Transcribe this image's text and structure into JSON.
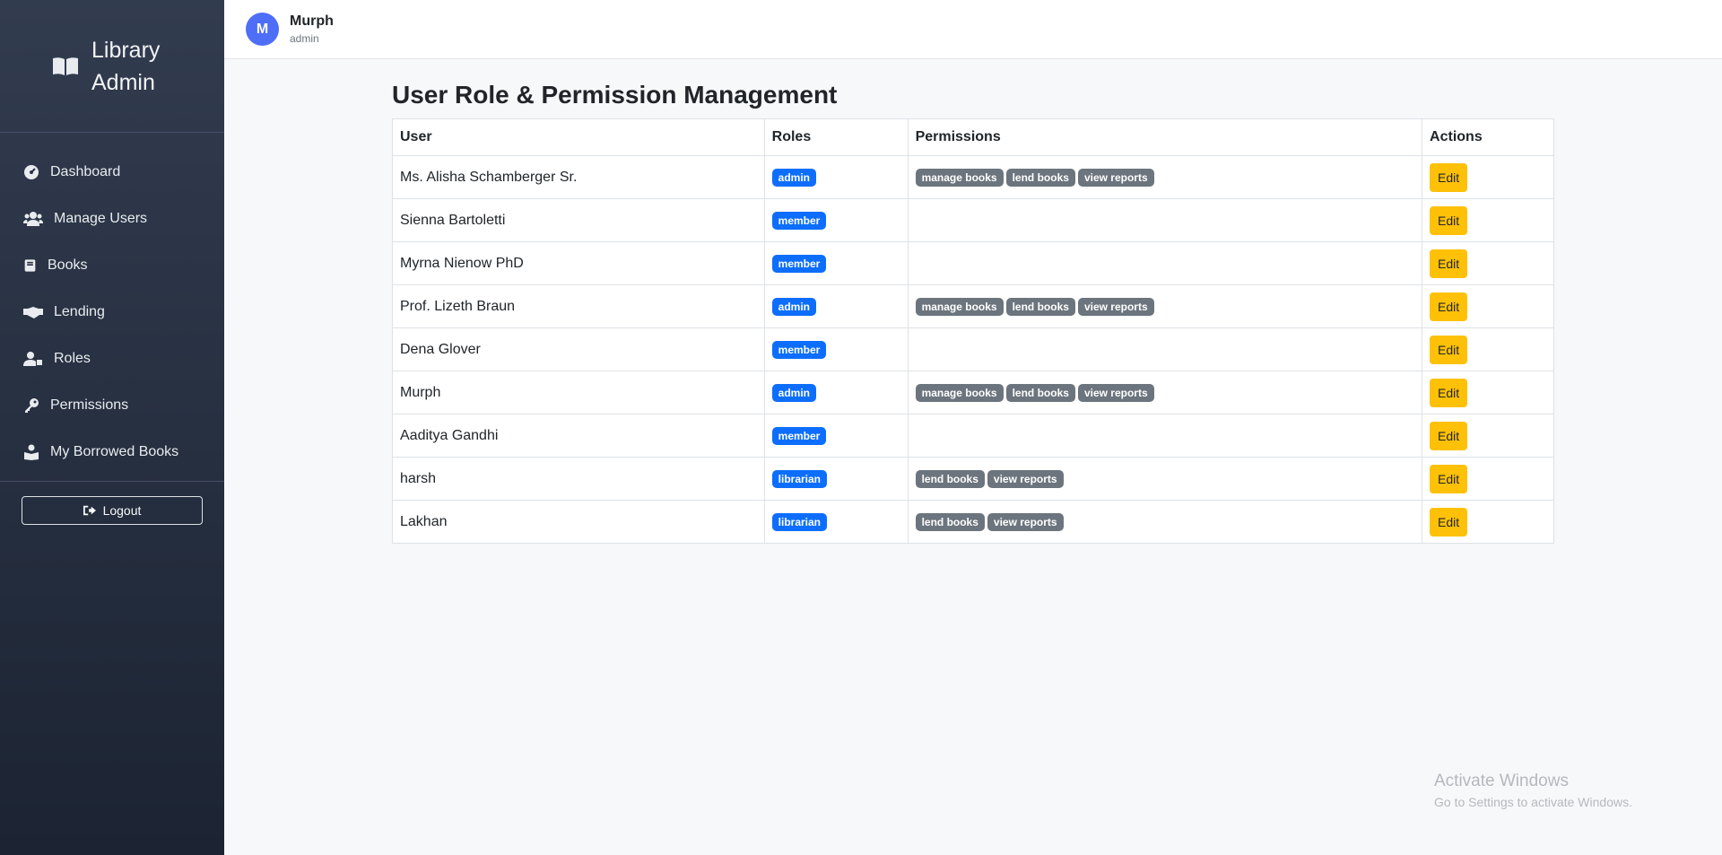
{
  "sidebar": {
    "brand": "Library Admin",
    "items": [
      {
        "label": "Dashboard",
        "icon": "dashboard-icon"
      },
      {
        "label": "Manage Users",
        "icon": "users-icon"
      },
      {
        "label": "Books",
        "icon": "book-icon"
      },
      {
        "label": "Lending",
        "icon": "handshake-icon"
      },
      {
        "label": "Roles",
        "icon": "user-tag-icon"
      },
      {
        "label": "Permissions",
        "icon": "key-icon"
      },
      {
        "label": "My Borrowed Books",
        "icon": "book-reader-icon"
      }
    ],
    "logout_label": "Logout"
  },
  "header": {
    "avatar_initial": "M",
    "user_name": "Murph",
    "user_role": "admin"
  },
  "main": {
    "title": "User Role & Permission Management",
    "columns": [
      "User",
      "Roles",
      "Permissions",
      "Actions"
    ],
    "edit_label": "Edit",
    "rows": [
      {
        "user": "Ms. Alisha Schamberger Sr.",
        "roles": [
          "admin"
        ],
        "permissions": [
          "manage books",
          "lend books",
          "view reports"
        ]
      },
      {
        "user": "Sienna Bartoletti",
        "roles": [
          "member"
        ],
        "permissions": []
      },
      {
        "user": "Myrna Nienow PhD",
        "roles": [
          "member"
        ],
        "permissions": []
      },
      {
        "user": "Prof. Lizeth Braun",
        "roles": [
          "admin"
        ],
        "permissions": [
          "manage books",
          "lend books",
          "view reports"
        ]
      },
      {
        "user": "Dena Glover",
        "roles": [
          "member"
        ],
        "permissions": []
      },
      {
        "user": "Murph",
        "roles": [
          "admin"
        ],
        "permissions": [
          "manage books",
          "lend books",
          "view reports"
        ]
      },
      {
        "user": "Aaditya Gandhi",
        "roles": [
          "member"
        ],
        "permissions": []
      },
      {
        "user": "harsh",
        "roles": [
          "librarian"
        ],
        "permissions": [
          "lend books",
          "view reports"
        ]
      },
      {
        "user": "Lakhan",
        "roles": [
          "librarian"
        ],
        "permissions": [
          "lend books",
          "view reports"
        ]
      }
    ]
  },
  "watermark": {
    "line1": "Activate Windows",
    "line2": "Go to Settings to activate Windows."
  },
  "colors": {
    "role_badge": "#0d6efd",
    "permission_badge": "#6c757d",
    "edit_button": "#ffc107",
    "avatar": "#4f6ef7"
  }
}
